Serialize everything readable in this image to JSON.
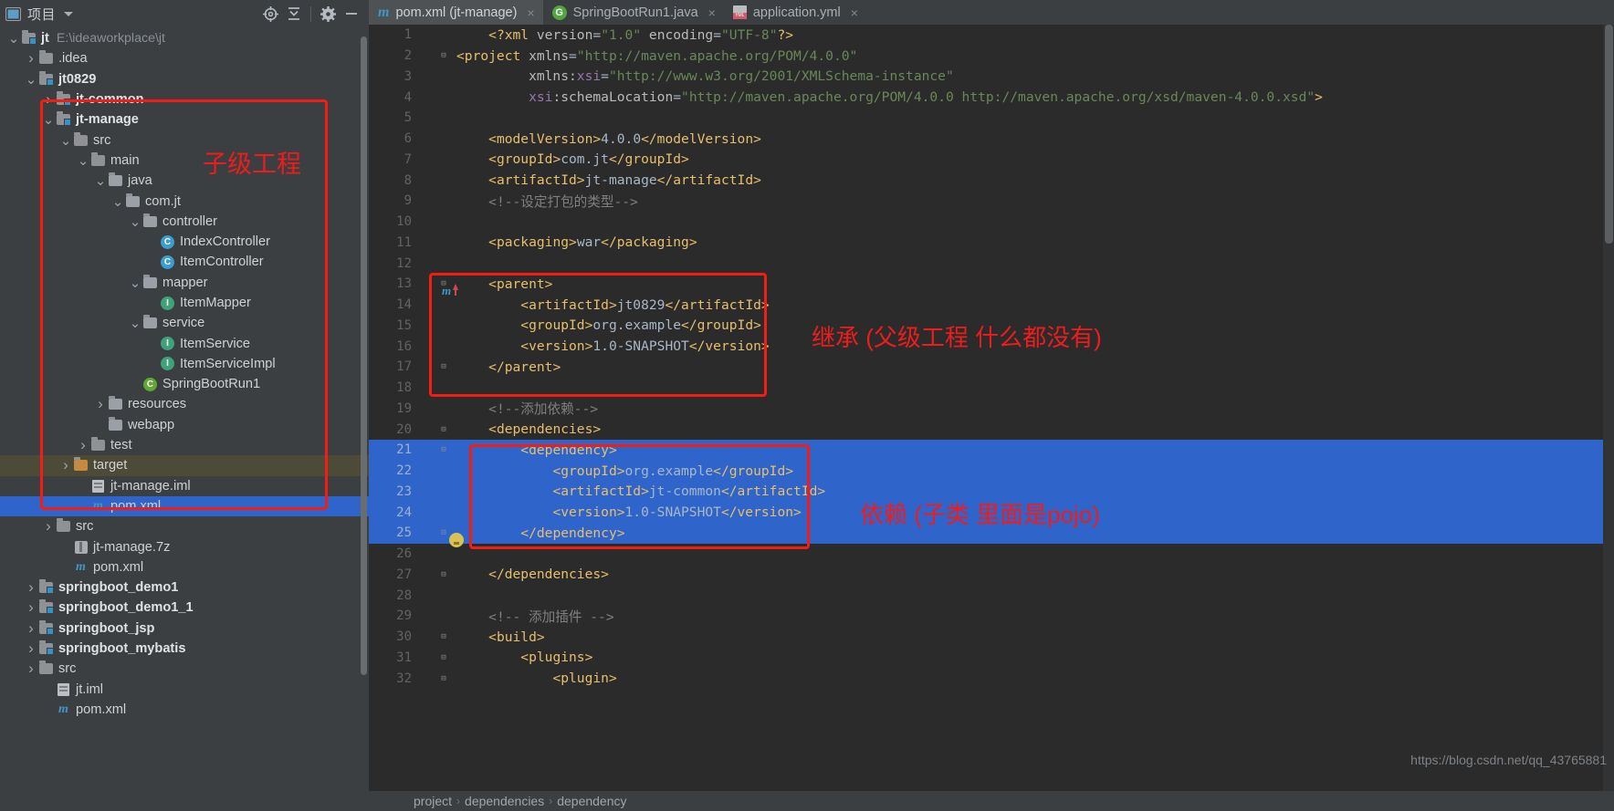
{
  "project_panel": {
    "title": "项目",
    "icons": [
      "project-window-icon",
      "target-icon",
      "collapse-all-icon",
      "gear-icon",
      "minimize-icon"
    ],
    "tree": [
      {
        "indent": 0,
        "arrow": "v",
        "icon": "folder-module",
        "label": "jt",
        "bold": true,
        "path": "E:\\ideaworkplace\\jt",
        "state": "none"
      },
      {
        "indent": 1,
        "arrow": ">",
        "icon": "folder",
        "label": ".idea",
        "bold": false,
        "path": "",
        "state": "none"
      },
      {
        "indent": 1,
        "arrow": "v",
        "icon": "folder-module",
        "label": "jt0829",
        "bold": true,
        "path": "",
        "state": "none"
      },
      {
        "indent": 2,
        "arrow": ">",
        "icon": "folder-module",
        "label": "jt-common",
        "bold": true,
        "path": "",
        "state": "none"
      },
      {
        "indent": 2,
        "arrow": "v",
        "icon": "folder-module",
        "label": "jt-manage",
        "bold": true,
        "path": "",
        "state": "none"
      },
      {
        "indent": 3,
        "arrow": "v",
        "icon": "folder",
        "label": "src",
        "bold": false,
        "path": "",
        "state": "none"
      },
      {
        "indent": 4,
        "arrow": "v",
        "icon": "folder",
        "label": "main",
        "bold": false,
        "path": "",
        "state": "none"
      },
      {
        "indent": 5,
        "arrow": "v",
        "icon": "folder-src",
        "label": "java",
        "bold": false,
        "path": "",
        "state": "none"
      },
      {
        "indent": 6,
        "arrow": "v",
        "icon": "folder-pkg",
        "label": "com.jt",
        "bold": false,
        "path": "",
        "state": "none"
      },
      {
        "indent": 7,
        "arrow": "v",
        "icon": "folder-pkg",
        "label": "controller",
        "bold": false,
        "path": "",
        "state": "none"
      },
      {
        "indent": 8,
        "arrow": "",
        "icon": "class-icon",
        "label": "IndexController",
        "bold": false,
        "path": "",
        "state": "none"
      },
      {
        "indent": 8,
        "arrow": "",
        "icon": "class-icon",
        "label": "ItemController",
        "bold": false,
        "path": "",
        "state": "none"
      },
      {
        "indent": 7,
        "arrow": "v",
        "icon": "folder-pkg",
        "label": "mapper",
        "bold": false,
        "path": "",
        "state": "none"
      },
      {
        "indent": 8,
        "arrow": "",
        "icon": "interface-icon",
        "label": "ItemMapper",
        "bold": false,
        "path": "",
        "state": "none"
      },
      {
        "indent": 7,
        "arrow": "v",
        "icon": "folder-pkg",
        "label": "service",
        "bold": false,
        "path": "",
        "state": "none"
      },
      {
        "indent": 8,
        "arrow": "",
        "icon": "interface-icon",
        "label": "ItemService",
        "bold": false,
        "path": "",
        "state": "none"
      },
      {
        "indent": 8,
        "arrow": "",
        "icon": "interface-icon",
        "label": "ItemServiceImpl",
        "bold": false,
        "path": "",
        "state": "none"
      },
      {
        "indent": 7,
        "arrow": "",
        "icon": "spring-class-icon",
        "label": "SpringBootRun1",
        "bold": false,
        "path": "",
        "state": "none"
      },
      {
        "indent": 5,
        "arrow": ">",
        "icon": "folder-res",
        "label": "resources",
        "bold": false,
        "path": "",
        "state": "none"
      },
      {
        "indent": 5,
        "arrow": "",
        "icon": "folder-res",
        "label": "webapp",
        "bold": false,
        "path": "",
        "state": "none"
      },
      {
        "indent": 4,
        "arrow": ">",
        "icon": "folder",
        "label": "test",
        "bold": false,
        "path": "",
        "state": "none"
      },
      {
        "indent": 3,
        "arrow": ">",
        "icon": "folder-target",
        "label": "target",
        "bold": false,
        "path": "",
        "state": "highlight"
      },
      {
        "indent": 4,
        "arrow": "",
        "icon": "iml-icon",
        "label": "jt-manage.iml",
        "bold": false,
        "path": "",
        "state": "none"
      },
      {
        "indent": 4,
        "arrow": "",
        "icon": "maven-icon",
        "label": "pom.xml",
        "bold": false,
        "path": "",
        "state": "selected"
      },
      {
        "indent": 2,
        "arrow": ">",
        "icon": "folder",
        "label": "src",
        "bold": false,
        "path": "",
        "state": "none"
      },
      {
        "indent": 3,
        "arrow": "",
        "icon": "archive-icon",
        "label": "jt-manage.7z",
        "bold": false,
        "path": "",
        "state": "none"
      },
      {
        "indent": 3,
        "arrow": "",
        "icon": "maven-icon",
        "label": "pom.xml",
        "bold": false,
        "path": "",
        "state": "none"
      },
      {
        "indent": 1,
        "arrow": ">",
        "icon": "folder-module",
        "label": "springboot_demo1",
        "bold": true,
        "path": "",
        "state": "none"
      },
      {
        "indent": 1,
        "arrow": ">",
        "icon": "folder-module",
        "label": "springboot_demo1_1",
        "bold": true,
        "path": "",
        "state": "none"
      },
      {
        "indent": 1,
        "arrow": ">",
        "icon": "folder-module",
        "label": "springboot_jsp",
        "bold": true,
        "path": "",
        "state": "none"
      },
      {
        "indent": 1,
        "arrow": ">",
        "icon": "folder-module",
        "label": "springboot_mybatis",
        "bold": true,
        "path": "",
        "state": "none"
      },
      {
        "indent": 1,
        "arrow": ">",
        "icon": "folder",
        "label": "src",
        "bold": false,
        "path": "",
        "state": "none"
      },
      {
        "indent": 2,
        "arrow": "",
        "icon": "iml-icon",
        "label": "jt.iml",
        "bold": false,
        "path": "",
        "state": "none"
      },
      {
        "indent": 2,
        "arrow": "",
        "icon": "maven-icon",
        "label": "pom.xml",
        "bold": false,
        "path": "",
        "state": "none"
      }
    ]
  },
  "tabs": [
    {
      "label": "pom.xml (jt-manage)",
      "icon": "maven-file-icon",
      "active": true,
      "close": "×"
    },
    {
      "label": "SpringBootRun1.java",
      "icon": "spring-icon",
      "active": false,
      "close": "×"
    },
    {
      "label": "application.yml",
      "icon": "yml-icon",
      "active": false,
      "close": "×"
    }
  ],
  "editor": {
    "lines": [
      {
        "n": 1,
        "fold": "",
        "mark": "",
        "tokens": [
          {
            "t": "    ",
            "c": "txt"
          },
          {
            "t": "<?xml ",
            "c": "pi"
          },
          {
            "t": "version",
            "c": "attr"
          },
          {
            "t": "=",
            "c": "txt"
          },
          {
            "t": "\"1.0\"",
            "c": "val"
          },
          {
            "t": " encoding",
            "c": "attr"
          },
          {
            "t": "=",
            "c": "txt"
          },
          {
            "t": "\"UTF-8\"",
            "c": "val"
          },
          {
            "t": "?>",
            "c": "pi"
          }
        ]
      },
      {
        "n": 2,
        "fold": "-",
        "mark": "",
        "tokens": [
          {
            "t": "",
            "c": "txt"
          },
          {
            "t": "<project ",
            "c": "tag"
          },
          {
            "t": "xmlns",
            "c": "attr"
          },
          {
            "t": "=",
            "c": "txt"
          },
          {
            "t": "\"http://maven.apache.org/POM/4.0.0\"",
            "c": "val"
          }
        ]
      },
      {
        "n": 3,
        "fold": "",
        "mark": "",
        "tokens": [
          {
            "t": "         ",
            "c": "txt"
          },
          {
            "t": "xmlns:",
            "c": "attr"
          },
          {
            "t": "xsi",
            "c": "ns"
          },
          {
            "t": "=",
            "c": "txt"
          },
          {
            "t": "\"http://www.w3.org/2001/XMLSchema-instance\"",
            "c": "val"
          }
        ]
      },
      {
        "n": 4,
        "fold": "",
        "mark": "",
        "tokens": [
          {
            "t": "         ",
            "c": "txt"
          },
          {
            "t": "xsi",
            "c": "ns"
          },
          {
            "t": ":schemaLocation",
            "c": "attr"
          },
          {
            "t": "=",
            "c": "txt"
          },
          {
            "t": "\"http://maven.apache.org/POM/4.0.0 http://maven.apache.org/xsd/maven-4.0.0.xsd\"",
            "c": "val"
          },
          {
            "t": ">",
            "c": "tag"
          }
        ]
      },
      {
        "n": 5,
        "fold": "",
        "mark": "",
        "tokens": []
      },
      {
        "n": 6,
        "fold": "",
        "mark": "",
        "tokens": [
          {
            "t": "    ",
            "c": "txt"
          },
          {
            "t": "<modelVersion>",
            "c": "tag"
          },
          {
            "t": "4.0.0",
            "c": "txt"
          },
          {
            "t": "</modelVersion>",
            "c": "tag"
          }
        ]
      },
      {
        "n": 7,
        "fold": "",
        "mark": "",
        "tokens": [
          {
            "t": "    ",
            "c": "txt"
          },
          {
            "t": "<groupId>",
            "c": "tag"
          },
          {
            "t": "com.jt",
            "c": "txt"
          },
          {
            "t": "</groupId>",
            "c": "tag"
          }
        ]
      },
      {
        "n": 8,
        "fold": "",
        "mark": "",
        "tokens": [
          {
            "t": "    ",
            "c": "txt"
          },
          {
            "t": "<artifactId>",
            "c": "tag"
          },
          {
            "t": "jt-manage",
            "c": "txt"
          },
          {
            "t": "</artifactId>",
            "c": "tag"
          }
        ]
      },
      {
        "n": 9,
        "fold": "",
        "mark": "",
        "tokens": [
          {
            "t": "    ",
            "c": "txt"
          },
          {
            "t": "<!--设定打包的类型-->",
            "c": "cmt"
          }
        ]
      },
      {
        "n": 10,
        "fold": "",
        "mark": "",
        "tokens": []
      },
      {
        "n": 11,
        "fold": "",
        "mark": "",
        "tokens": [
          {
            "t": "    ",
            "c": "txt"
          },
          {
            "t": "<packaging>",
            "c": "tag"
          },
          {
            "t": "war",
            "c": "txt"
          },
          {
            "t": "</packaging>",
            "c": "tag"
          }
        ]
      },
      {
        "n": 12,
        "fold": "",
        "mark": "",
        "tokens": []
      },
      {
        "n": 13,
        "fold": "-",
        "mark": "maven-reimport",
        "tokens": [
          {
            "t": "    ",
            "c": "txt"
          },
          {
            "t": "<parent>",
            "c": "tag"
          }
        ]
      },
      {
        "n": 14,
        "fold": "",
        "mark": "",
        "tokens": [
          {
            "t": "        ",
            "c": "txt"
          },
          {
            "t": "<artifactId>",
            "c": "tag"
          },
          {
            "t": "jt0829",
            "c": "txt"
          },
          {
            "t": "</artifactId>",
            "c": "tag"
          }
        ]
      },
      {
        "n": 15,
        "fold": "",
        "mark": "",
        "tokens": [
          {
            "t": "        ",
            "c": "txt"
          },
          {
            "t": "<groupId>",
            "c": "tag"
          },
          {
            "t": "org.example",
            "c": "txt"
          },
          {
            "t": "</groupId>",
            "c": "tag"
          }
        ]
      },
      {
        "n": 16,
        "fold": "",
        "mark": "",
        "tokens": [
          {
            "t": "        ",
            "c": "txt"
          },
          {
            "t": "<version>",
            "c": "tag"
          },
          {
            "t": "1.0-SNAPSHOT",
            "c": "txt"
          },
          {
            "t": "</version>",
            "c": "tag"
          }
        ]
      },
      {
        "n": 17,
        "fold": "-",
        "mark": "",
        "tokens": [
          {
            "t": "    ",
            "c": "txt"
          },
          {
            "t": "</parent>",
            "c": "tag"
          }
        ]
      },
      {
        "n": 18,
        "fold": "",
        "mark": "",
        "tokens": []
      },
      {
        "n": 19,
        "fold": "",
        "mark": "",
        "tokens": [
          {
            "t": "    ",
            "c": "txt"
          },
          {
            "t": "<!--添加依赖-->",
            "c": "cmt"
          }
        ]
      },
      {
        "n": 20,
        "fold": "-",
        "mark": "",
        "tokens": [
          {
            "t": "    ",
            "c": "txt"
          },
          {
            "t": "<dependencies>",
            "c": "tag"
          }
        ]
      },
      {
        "n": 21,
        "fold": "-",
        "mark": "",
        "tokens": [
          {
            "t": "        ",
            "c": "txt"
          },
          {
            "t": "<dependency>",
            "c": "tag"
          }
        ]
      },
      {
        "n": 22,
        "fold": "",
        "mark": "",
        "tokens": [
          {
            "t": "            ",
            "c": "txt"
          },
          {
            "t": "<groupId>",
            "c": "tag"
          },
          {
            "t": "org.example",
            "c": "txt"
          },
          {
            "t": "</groupId>",
            "c": "tag"
          }
        ]
      },
      {
        "n": 23,
        "fold": "",
        "mark": "",
        "tokens": [
          {
            "t": "            ",
            "c": "txt"
          },
          {
            "t": "<artifactId>",
            "c": "tag"
          },
          {
            "t": "jt-common",
            "c": "txt"
          },
          {
            "t": "</artifactId>",
            "c": "tag"
          }
        ]
      },
      {
        "n": 24,
        "fold": "",
        "mark": "",
        "tokens": [
          {
            "t": "            ",
            "c": "txt"
          },
          {
            "t": "<version>",
            "c": "tag"
          },
          {
            "t": "1.0-SNAPSHOT",
            "c": "txt"
          },
          {
            "t": "</version>",
            "c": "tag"
          }
        ]
      },
      {
        "n": 25,
        "fold": "-",
        "mark": "bulb",
        "tokens": [
          {
            "t": "        ",
            "c": "txt"
          },
          {
            "t": "</dependency>",
            "c": "tag"
          }
        ]
      },
      {
        "n": 26,
        "fold": "",
        "mark": "",
        "tokens": []
      },
      {
        "n": 27,
        "fold": "-",
        "mark": "",
        "tokens": [
          {
            "t": "    ",
            "c": "txt"
          },
          {
            "t": "</dependencies>",
            "c": "tag"
          }
        ]
      },
      {
        "n": 28,
        "fold": "",
        "mark": "",
        "tokens": []
      },
      {
        "n": 29,
        "fold": "",
        "mark": "",
        "tokens": [
          {
            "t": "    ",
            "c": "txt"
          },
          {
            "t": "<!-- 添加插件 -->",
            "c": "cmt"
          }
        ]
      },
      {
        "n": 30,
        "fold": "-",
        "mark": "",
        "tokens": [
          {
            "t": "    ",
            "c": "txt"
          },
          {
            "t": "<build>",
            "c": "tag"
          }
        ]
      },
      {
        "n": 31,
        "fold": "-",
        "mark": "",
        "tokens": [
          {
            "t": "        ",
            "c": "txt"
          },
          {
            "t": "<plugins>",
            "c": "tag"
          }
        ]
      },
      {
        "n": 32,
        "fold": "-",
        "mark": "",
        "tokens": [
          {
            "t": "            ",
            "c": "txt"
          },
          {
            "t": "<plugin>",
            "c": "tag"
          }
        ]
      }
    ],
    "highlight_rows": [
      21,
      22,
      23,
      24,
      25
    ]
  },
  "annotations": [
    {
      "id": "sub-project",
      "text": "子级工程",
      "color": "#f01c1c"
    },
    {
      "id": "inherit",
      "text": "继承 (父级工程 什么都没有)",
      "color": "#f01c1c"
    },
    {
      "id": "dependency",
      "text": "依赖 (子类 里面是pojo)",
      "color": "#f01c1c"
    }
  ],
  "breadcrumbs": [
    "project",
    "dependencies",
    "dependency"
  ],
  "watermark": "https://blog.csdn.net/qq_43765881",
  "colors": {
    "accent_blue": "#2f65ca",
    "annotation_red": "#f01c1c",
    "editor_bg": "#2b2b2b",
    "panel_bg": "#3c3f41"
  }
}
